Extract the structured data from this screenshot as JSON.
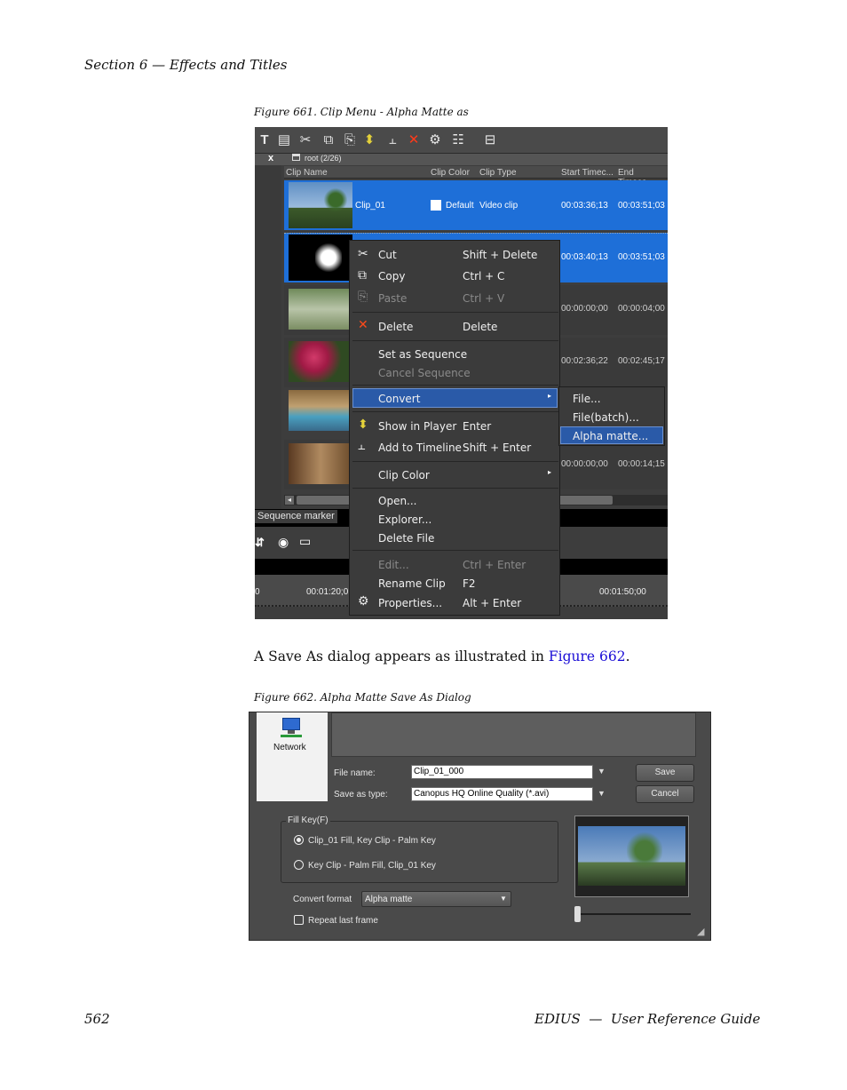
{
  "header": {
    "section": "Section 6 — Effects and Titles"
  },
  "figure1": {
    "caption": "Figure 661.  Clip Menu - Alpha Matte as",
    "toolbar_icons": [
      "title-icon",
      "color-bars-icon",
      "cut-icon",
      "copy-icon",
      "paste-icon",
      "show-in-player-icon",
      "add-to-timeline-icon",
      "delete-icon",
      "properties-icon",
      "view-icon",
      "briefcase-icon"
    ],
    "bin": {
      "close": "x",
      "path": "root (2/26)"
    },
    "columns": [
      "Clip Name",
      "Clip Color",
      "Clip Type",
      "Start Timec...",
      "End Timeco..."
    ],
    "rows": [
      {
        "name": "Clip_01",
        "color": "Default",
        "type": "Video clip",
        "start": "00:03:36;13",
        "end": "00:03:51;03"
      },
      {
        "start": "00:03:40;13",
        "end": "00:03:51;03"
      },
      {
        "start": "00:00:00;00",
        "end": "00:00:04;00"
      },
      {
        "start": "00:02:36;22",
        "end": "00:02:45;17"
      },
      {
        "start": "00:00:00;00",
        "end": "00:00:14;15"
      }
    ],
    "sequence_marker": "Sequence marker",
    "timeline": {
      "left_tc": "00:01:20;0",
      "right_tc": "00:01:50;00",
      "left_edge": "0"
    },
    "menu": {
      "cut": "Cut",
      "cut_sc": "Shift + Delete",
      "copy": "Copy",
      "copy_sc": "Ctrl + C",
      "paste": "Paste",
      "paste_sc": "Ctrl + V",
      "delete": "Delete",
      "delete_sc": "Delete",
      "set_seq": "Set as Sequence",
      "cancel_seq": "Cancel Sequence",
      "convert": "Convert",
      "show_player": "Show in Player",
      "show_player_sc": "Enter",
      "add_timeline": "Add to Timeline",
      "add_timeline_sc": "Shift + Enter",
      "clip_color": "Clip Color",
      "open": "Open...",
      "explorer": "Explorer...",
      "delete_file": "Delete File",
      "edit": "Edit...",
      "edit_sc": "Ctrl + Enter",
      "rename": "Rename Clip",
      "rename_sc": "F2",
      "properties": "Properties...",
      "properties_sc": "Alt + Enter"
    },
    "submenu": {
      "file": "File...",
      "file_batch": "File(batch)...",
      "alpha_matte": "Alpha matte..."
    }
  },
  "body_text": {
    "before_link": "A Save As dialog appears as illustrated in ",
    "link": "Figure 662",
    "after_link": "."
  },
  "figure2": {
    "caption": "Figure 662.  Alpha Matte Save As Dialog",
    "network": "Network",
    "file_name_label": "File name:",
    "file_name_value": "Clip_01_000",
    "save_type_label": "Save as type:",
    "save_type_value": "Canopus HQ Online Quality (*.avi)",
    "save_button": "Save",
    "cancel_button": "Cancel",
    "fill_key_group": "Fill Key(F)",
    "option1": "Clip_01 Fill, Key Clip - Palm Key",
    "option2": "Key Clip - Palm Fill, Clip_01 Key",
    "convert_format_label": "Convert format",
    "convert_format_value": "Alpha matte",
    "repeat_last_frame": "Repeat last frame"
  },
  "footer": {
    "page_number": "562",
    "guide": "EDIUS  —  User Reference Guide"
  },
  "colors": {
    "selection": "#1e6fd8",
    "link": "#1a0dd6",
    "menu_bg": "#3b3b3b"
  }
}
